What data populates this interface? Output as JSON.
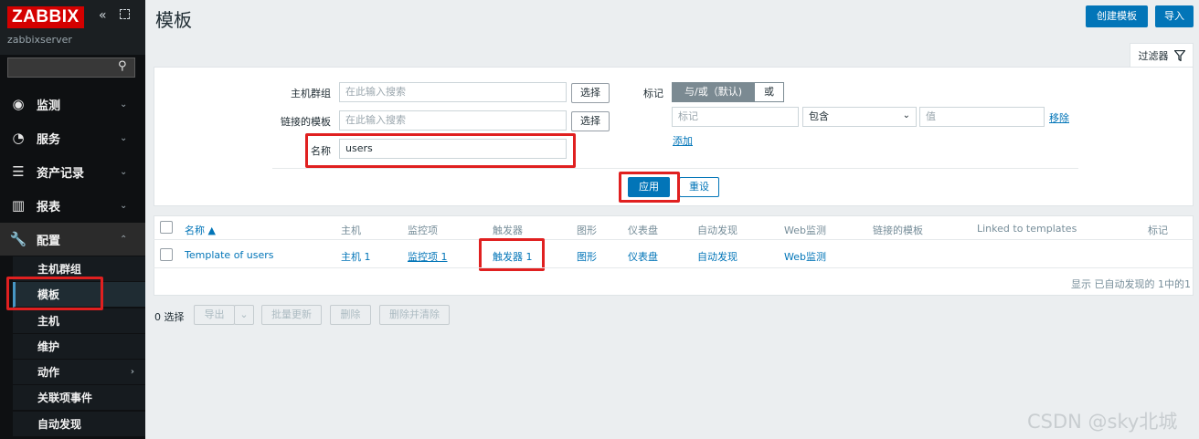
{
  "sidebar": {
    "logo": "ZABBIX",
    "server_name": "zabbixserver",
    "search_placeholder": "",
    "menu": [
      {
        "label": "监测",
        "icon": "eye-icon"
      },
      {
        "label": "服务",
        "icon": "clock-icon"
      },
      {
        "label": "资产记录",
        "icon": "list-icon"
      },
      {
        "label": "报表",
        "icon": "bar-chart-icon"
      },
      {
        "label": "配置",
        "icon": "wrench-icon"
      }
    ],
    "submenu": [
      "主机群组",
      "模板",
      "主机",
      "维护",
      "动作",
      "关联项事件",
      "自动发现"
    ]
  },
  "header": {
    "title": "模板",
    "create_button": "创建模板",
    "import_button": "导入"
  },
  "filter": {
    "tab_label": "过滤器",
    "host_group_label": "主机群组",
    "host_group_placeholder": "在此输入搜索",
    "linked_templates_label": "链接的模板",
    "linked_templates_placeholder": "在此输入搜索",
    "select_button": "选择",
    "name_label": "名称",
    "name_value": "users",
    "tags_label": "标记",
    "tags_and_or": "与/或（默认)",
    "tags_or": "或",
    "tag_placeholder": "标记",
    "tag_operator": "包含",
    "tag_value_placeholder": "值",
    "remove_link": "移除",
    "add_link": "添加",
    "apply_button": "应用",
    "reset_button": "重设"
  },
  "table": {
    "headers": [
      "名称 ▲",
      "主机",
      "监控项",
      "触发器",
      "图形",
      "仪表盘",
      "自动发现",
      "Web监测",
      "链接的模板",
      "Linked to templates",
      "标记"
    ],
    "rows": [
      {
        "name": "Template of users",
        "hosts": "主机 1",
        "items": "监控项 1",
        "triggers": "触发器 1",
        "graphs": "图形",
        "dashboards": "仪表盘",
        "discovery": "自动发现",
        "web": "Web监测"
      }
    ],
    "footer": "显示 已自动发现的 1中的1"
  },
  "actions": {
    "selected": "0 选择",
    "export": "导出",
    "mass_update": "批量更新",
    "delete": "删除",
    "delete_clear": "删除并清除"
  },
  "watermark": "CSDN @sky北城"
}
